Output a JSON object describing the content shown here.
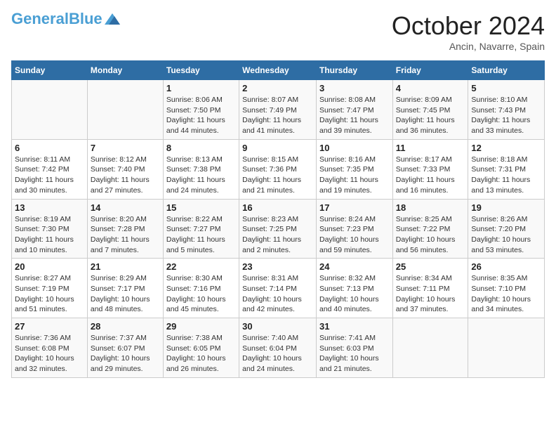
{
  "logo": {
    "general": "General",
    "blue": "Blue"
  },
  "title": "October 2024",
  "location": "Ancin, Navarre, Spain",
  "days_header": [
    "Sunday",
    "Monday",
    "Tuesday",
    "Wednesday",
    "Thursday",
    "Friday",
    "Saturday"
  ],
  "weeks": [
    [
      {
        "num": "",
        "info": ""
      },
      {
        "num": "",
        "info": ""
      },
      {
        "num": "1",
        "info": "Sunrise: 8:06 AM\nSunset: 7:50 PM\nDaylight: 11 hours and 44 minutes."
      },
      {
        "num": "2",
        "info": "Sunrise: 8:07 AM\nSunset: 7:49 PM\nDaylight: 11 hours and 41 minutes."
      },
      {
        "num": "3",
        "info": "Sunrise: 8:08 AM\nSunset: 7:47 PM\nDaylight: 11 hours and 39 minutes."
      },
      {
        "num": "4",
        "info": "Sunrise: 8:09 AM\nSunset: 7:45 PM\nDaylight: 11 hours and 36 minutes."
      },
      {
        "num": "5",
        "info": "Sunrise: 8:10 AM\nSunset: 7:43 PM\nDaylight: 11 hours and 33 minutes."
      }
    ],
    [
      {
        "num": "6",
        "info": "Sunrise: 8:11 AM\nSunset: 7:42 PM\nDaylight: 11 hours and 30 minutes."
      },
      {
        "num": "7",
        "info": "Sunrise: 8:12 AM\nSunset: 7:40 PM\nDaylight: 11 hours and 27 minutes."
      },
      {
        "num": "8",
        "info": "Sunrise: 8:13 AM\nSunset: 7:38 PM\nDaylight: 11 hours and 24 minutes."
      },
      {
        "num": "9",
        "info": "Sunrise: 8:15 AM\nSunset: 7:36 PM\nDaylight: 11 hours and 21 minutes."
      },
      {
        "num": "10",
        "info": "Sunrise: 8:16 AM\nSunset: 7:35 PM\nDaylight: 11 hours and 19 minutes."
      },
      {
        "num": "11",
        "info": "Sunrise: 8:17 AM\nSunset: 7:33 PM\nDaylight: 11 hours and 16 minutes."
      },
      {
        "num": "12",
        "info": "Sunrise: 8:18 AM\nSunset: 7:31 PM\nDaylight: 11 hours and 13 minutes."
      }
    ],
    [
      {
        "num": "13",
        "info": "Sunrise: 8:19 AM\nSunset: 7:30 PM\nDaylight: 11 hours and 10 minutes."
      },
      {
        "num": "14",
        "info": "Sunrise: 8:20 AM\nSunset: 7:28 PM\nDaylight: 11 hours and 7 minutes."
      },
      {
        "num": "15",
        "info": "Sunrise: 8:22 AM\nSunset: 7:27 PM\nDaylight: 11 hours and 5 minutes."
      },
      {
        "num": "16",
        "info": "Sunrise: 8:23 AM\nSunset: 7:25 PM\nDaylight: 11 hours and 2 minutes."
      },
      {
        "num": "17",
        "info": "Sunrise: 8:24 AM\nSunset: 7:23 PM\nDaylight: 10 hours and 59 minutes."
      },
      {
        "num": "18",
        "info": "Sunrise: 8:25 AM\nSunset: 7:22 PM\nDaylight: 10 hours and 56 minutes."
      },
      {
        "num": "19",
        "info": "Sunrise: 8:26 AM\nSunset: 7:20 PM\nDaylight: 10 hours and 53 minutes."
      }
    ],
    [
      {
        "num": "20",
        "info": "Sunrise: 8:27 AM\nSunset: 7:19 PM\nDaylight: 10 hours and 51 minutes."
      },
      {
        "num": "21",
        "info": "Sunrise: 8:29 AM\nSunset: 7:17 PM\nDaylight: 10 hours and 48 minutes."
      },
      {
        "num": "22",
        "info": "Sunrise: 8:30 AM\nSunset: 7:16 PM\nDaylight: 10 hours and 45 minutes."
      },
      {
        "num": "23",
        "info": "Sunrise: 8:31 AM\nSunset: 7:14 PM\nDaylight: 10 hours and 42 minutes."
      },
      {
        "num": "24",
        "info": "Sunrise: 8:32 AM\nSunset: 7:13 PM\nDaylight: 10 hours and 40 minutes."
      },
      {
        "num": "25",
        "info": "Sunrise: 8:34 AM\nSunset: 7:11 PM\nDaylight: 10 hours and 37 minutes."
      },
      {
        "num": "26",
        "info": "Sunrise: 8:35 AM\nSunset: 7:10 PM\nDaylight: 10 hours and 34 minutes."
      }
    ],
    [
      {
        "num": "27",
        "info": "Sunrise: 7:36 AM\nSunset: 6:08 PM\nDaylight: 10 hours and 32 minutes."
      },
      {
        "num": "28",
        "info": "Sunrise: 7:37 AM\nSunset: 6:07 PM\nDaylight: 10 hours and 29 minutes."
      },
      {
        "num": "29",
        "info": "Sunrise: 7:38 AM\nSunset: 6:05 PM\nDaylight: 10 hours and 26 minutes."
      },
      {
        "num": "30",
        "info": "Sunrise: 7:40 AM\nSunset: 6:04 PM\nDaylight: 10 hours and 24 minutes."
      },
      {
        "num": "31",
        "info": "Sunrise: 7:41 AM\nSunset: 6:03 PM\nDaylight: 10 hours and 21 minutes."
      },
      {
        "num": "",
        "info": ""
      },
      {
        "num": "",
        "info": ""
      }
    ]
  ]
}
